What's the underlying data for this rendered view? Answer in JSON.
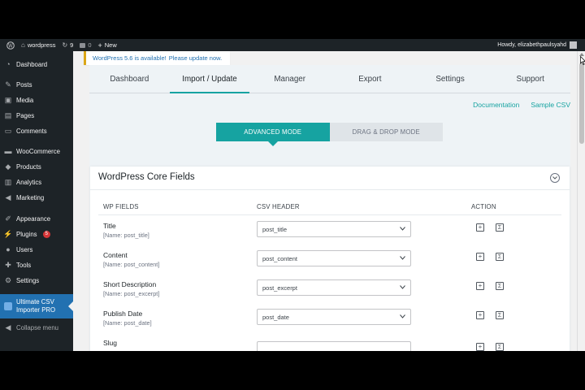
{
  "admin_bar": {
    "site_name": "wordpress",
    "updates_count": "9",
    "comments_count": "0",
    "new_label": "New",
    "howdy": "Howdy, elizabethpaulsyahd"
  },
  "sidebar": {
    "items": [
      {
        "label": "Dashboard",
        "icon": "dashboard-icon"
      },
      {
        "label": "Posts",
        "icon": "pin-icon"
      },
      {
        "label": "Media",
        "icon": "media-icon"
      },
      {
        "label": "Pages",
        "icon": "pages-icon"
      },
      {
        "label": "Comments",
        "icon": "comment-icon"
      },
      {
        "label": "WooCommerce",
        "icon": "woo-icon"
      },
      {
        "label": "Products",
        "icon": "box-icon"
      },
      {
        "label": "Analytics",
        "icon": "chart-icon"
      },
      {
        "label": "Marketing",
        "icon": "megaphone-icon"
      },
      {
        "label": "Appearance",
        "icon": "brush-icon"
      },
      {
        "label": "Plugins",
        "icon": "plug-icon",
        "badge": "5"
      },
      {
        "label": "Users",
        "icon": "user-icon"
      },
      {
        "label": "Tools",
        "icon": "wrench-icon"
      },
      {
        "label": "Settings",
        "icon": "settings-icon"
      }
    ],
    "active_item": {
      "label_line1": "Ultimate CSV",
      "label_line2": "Importer PRO"
    },
    "collapse_label": "Collapse menu"
  },
  "notice": {
    "text": "WordPress 5.6 is available!",
    "link": "Please update now."
  },
  "tabs": [
    "Dashboard",
    "Import / Update",
    "Manager",
    "Export",
    "Settings",
    "Support"
  ],
  "active_tab": "Import / Update",
  "links": {
    "documentation": "Documentation",
    "sample_csv": "Sample CSV"
  },
  "modes": {
    "advanced": "ADVANCED MODE",
    "drag_drop": "DRAG & DROP MODE"
  },
  "card": {
    "title": "WordPress Core Fields",
    "columns": {
      "wp_fields": "WP FIELDS",
      "csv_header": "CSV HEADER",
      "action": "ACTION"
    },
    "rows": [
      {
        "label": "Title",
        "name": "[Name: post_title]",
        "value": "post_title"
      },
      {
        "label": "Content",
        "name": "[Name: post_content]",
        "value": "post_content"
      },
      {
        "label": "Short Description",
        "name": "[Name: post_excerpt]",
        "value": "post_excerpt"
      },
      {
        "label": "Publish Date",
        "name": "[Name: post_date]",
        "value": "post_date"
      },
      {
        "label": "Slug",
        "name": "",
        "value": ""
      }
    ]
  },
  "colors": {
    "accent": "#16a3a1",
    "admin_dark": "#1d2327",
    "wp_blue": "#2271b1"
  }
}
